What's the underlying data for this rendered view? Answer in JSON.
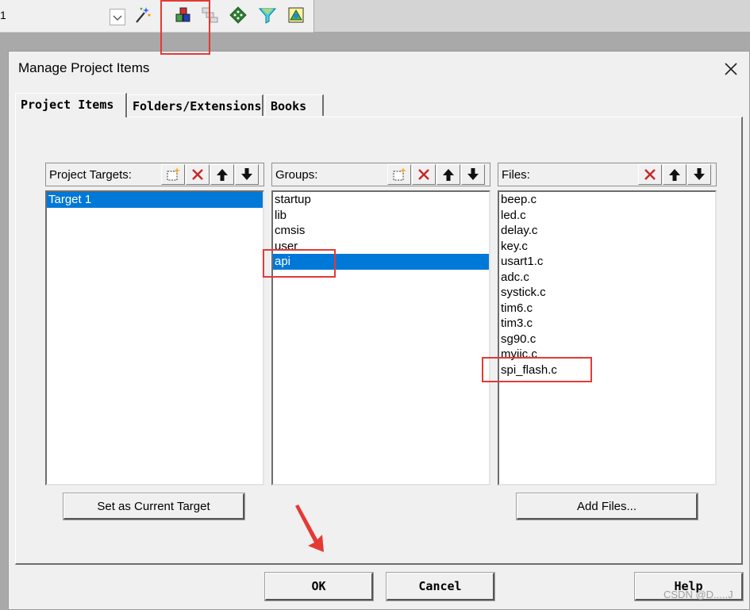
{
  "toolbar": {
    "left_text": "1",
    "icons": [
      "magic-wand-icon",
      "manage-project-items-icon",
      "batch-setup-icon",
      "green-diamond-icon",
      "funnel-icon",
      "packs-icon"
    ]
  },
  "dialog": {
    "title": "Manage Project Items",
    "tabs": [
      "Project Items",
      "Folders/Extensions",
      "Books"
    ],
    "targets": {
      "label": "Project Targets:",
      "items": [
        "Target 1"
      ],
      "selected": "Target 1"
    },
    "groups": {
      "label": "Groups:",
      "items": [
        "startup",
        "lib",
        "cmsis",
        "user",
        "api"
      ],
      "selected": "api"
    },
    "files": {
      "label": "Files:",
      "items": [
        "beep.c",
        "led.c",
        "delay.c",
        "key.c",
        "usart1.c",
        "adc.c",
        "systick.c",
        "tim6.c",
        "tim3.c",
        "sg90.c",
        "myiic.c",
        "spi_flash.c"
      ]
    },
    "set_target_button": "Set as Current Target",
    "add_files_button": "Add Files...",
    "ok_button": "OK",
    "cancel_button": "Cancel",
    "help_button": "Help"
  },
  "watermark": "CSDN @D.....J",
  "colors": {
    "selection": "#0078d7",
    "annotation": "#e53935"
  }
}
